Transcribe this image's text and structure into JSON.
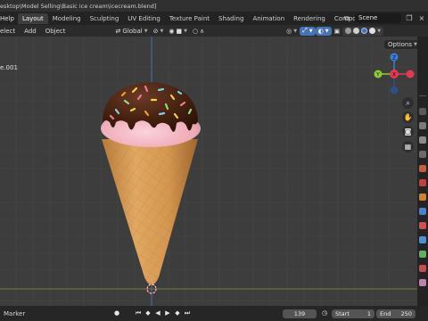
{
  "title_bar": {
    "path": "esktop\\Model Selling\\Basic ice cream\\icecream.blend]"
  },
  "top_bar": {
    "help_menu": "Help",
    "workspace_tabs": [
      {
        "label": "Layout",
        "active": true
      },
      {
        "label": "Modeling"
      },
      {
        "label": "Sculpting"
      },
      {
        "label": "UV Editing"
      },
      {
        "label": "Texture Paint"
      },
      {
        "label": "Shading"
      },
      {
        "label": "Animation"
      },
      {
        "label": "Rendering"
      },
      {
        "label": "Compositin"
      }
    ],
    "scene": "Scene"
  },
  "viewport_header": {
    "menus": [
      "elect",
      "Add",
      "Object"
    ],
    "transform_orientation": "Global",
    "options_label": "Options"
  },
  "viewport": {
    "object_name": "e.001",
    "axis_labels": {
      "y": "Y",
      "x": "X",
      "z": "Z"
    }
  },
  "timeline": {
    "marker_label": "Marker",
    "current_frame": "139",
    "start_label": "Start",
    "start_value": "1",
    "end_label": "End",
    "end_value": "250"
  },
  "colors": {
    "accent_blue": "#4772b3",
    "axis_x": "#e8384f",
    "axis_y": "#8bd02a",
    "axis_z": "#3b7fd6",
    "cone": "#d9a15a",
    "ice_cream": "#f0b2bd",
    "chocolate": "#4a2418"
  }
}
